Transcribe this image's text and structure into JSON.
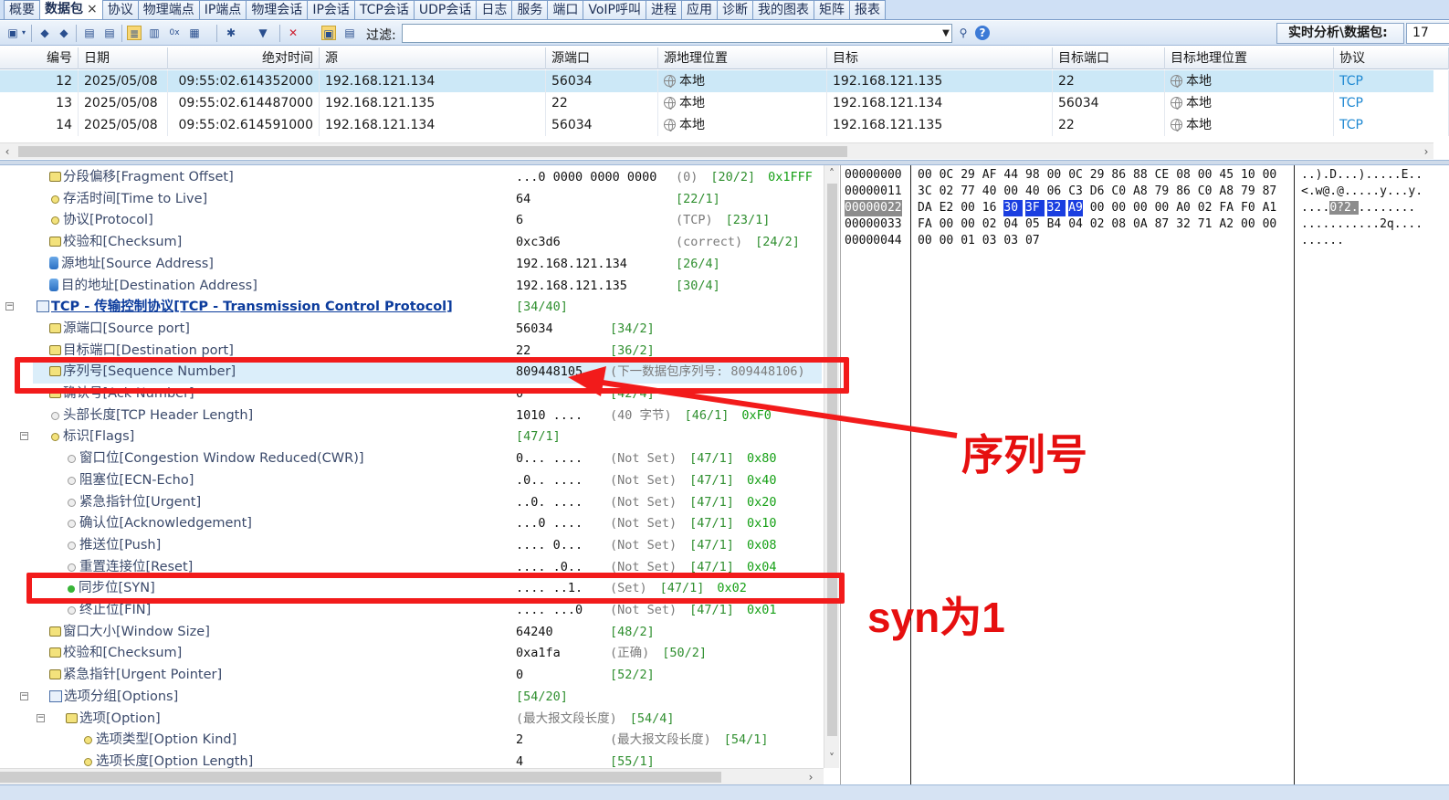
{
  "tabs": [
    {
      "label": "概要",
      "active": false
    },
    {
      "label": "数据包",
      "active": true,
      "close": "×"
    },
    {
      "label": "协议",
      "active": false
    },
    {
      "label": "物理端点",
      "active": false
    },
    {
      "label": "IP端点",
      "active": false
    },
    {
      "label": "物理会话",
      "active": false
    },
    {
      "label": "IP会话",
      "active": false
    },
    {
      "label": "TCP会话",
      "active": false
    },
    {
      "label": "UDP会话",
      "active": false
    },
    {
      "label": "日志",
      "active": false
    },
    {
      "label": "服务",
      "active": false
    },
    {
      "label": "端口",
      "active": false
    },
    {
      "label": "VoIP呼叫",
      "active": false
    },
    {
      "label": "进程",
      "active": false
    },
    {
      "label": "应用",
      "active": false
    },
    {
      "label": "诊断",
      "active": false
    },
    {
      "label": "我的图表",
      "active": false
    },
    {
      "label": "矩阵",
      "active": false
    },
    {
      "label": "报表",
      "active": false
    }
  ],
  "toolbar": {
    "filter_label": "过滤:",
    "filter_value": "",
    "realtime_label": "实时分析\\数据包:",
    "realtime_value": "17"
  },
  "packet_list": {
    "columns": [
      "编号",
      "日期",
      "绝对时间",
      "源",
      "源端口",
      "源地理位置",
      "目标",
      "目标端口",
      "目标地理位置",
      "协议"
    ],
    "rows": [
      {
        "no": "12",
        "date": "2025/05/08",
        "time": "09:55:02.614352000",
        "src": "192.168.121.134",
        "sport": "56034",
        "sgeo": "本地",
        "dst": "192.168.121.135",
        "dport": "22",
        "dgeo": "本地",
        "proto": "TCP",
        "selected": true
      },
      {
        "no": "13",
        "date": "2025/05/08",
        "time": "09:55:02.614487000",
        "src": "192.168.121.135",
        "sport": "22",
        "sgeo": "本地",
        "dst": "192.168.121.134",
        "dport": "56034",
        "dgeo": "本地",
        "proto": "TCP",
        "selected": false
      },
      {
        "no": "14",
        "date": "2025/05/08",
        "time": "09:55:02.614591000",
        "src": "192.168.121.134",
        "sport": "56034",
        "sgeo": "本地",
        "dst": "192.168.121.135",
        "dport": "22",
        "dgeo": "本地",
        "proto": "TCP",
        "selected": false
      }
    ]
  },
  "tree": [
    {
      "indent": 1,
      "icon": "field",
      "name": "分段偏移[Fragment Offset]",
      "value": "...0 0000 0000 0000",
      "desc": "(0)",
      "offset": "[20/2]",
      "hex": "0x1FFF"
    },
    {
      "indent": 1,
      "icon": "dot",
      "name": "存活时间[Time to Live]",
      "value": "64",
      "desc": "",
      "offset": "[22/1]",
      "hex": ""
    },
    {
      "indent": 1,
      "icon": "dot",
      "name": "协议[Protocol]",
      "value": "6",
      "desc": "(TCP)",
      "offset": "[23/1]",
      "hex": ""
    },
    {
      "indent": 1,
      "icon": "field",
      "name": "校验和[Checksum]",
      "value": "0xc3d6",
      "desc": "(correct)",
      "offset": "[24/2]",
      "hex": ""
    },
    {
      "indent": 1,
      "icon": "addr",
      "name": "源地址[Source Address]",
      "value": "192.168.121.134",
      "desc": "",
      "offset": "[26/4]",
      "hex": ""
    },
    {
      "indent": 1,
      "icon": "addr",
      "name": "目的地址[Destination Address]",
      "value": "192.168.121.135",
      "desc": "",
      "offset": "[30/4]",
      "hex": ""
    },
    {
      "indent": 0,
      "icon": "proto",
      "expander": "−",
      "name": "TCP - 传输控制协议[TCP - Transmission Control Protocol]",
      "value": "",
      "desc": "",
      "offset": "[34/40]",
      "hex": "",
      "title": true
    },
    {
      "indent": 1,
      "icon": "field",
      "name": "源端口[Source port]",
      "value": "56034",
      "desc": "",
      "offset": "[34/2]",
      "hex": ""
    },
    {
      "indent": 1,
      "icon": "field",
      "name": "目标端口[Destination port]",
      "value": "22",
      "desc": "",
      "offset": "[36/2]",
      "hex": ""
    },
    {
      "indent": 1,
      "icon": "field",
      "name": "序列号[Sequence Number]",
      "value": "809448105",
      "desc": "(下一数据包序列号: 809448106)",
      "offset": "",
      "hex": "",
      "highlight": true
    },
    {
      "indent": 1,
      "icon": "field",
      "name": "确认号[Ack Number]",
      "value": "0",
      "desc": "",
      "offset": "[42/4]",
      "hex": ""
    },
    {
      "indent": 1,
      "icon": "grey",
      "name": "头部长度[TCP Header Length]",
      "value": "1010 ....",
      "desc": "(40 字节)",
      "offset": "[46/1]",
      "hex": "0xF0"
    },
    {
      "indent": 1,
      "icon": "dot",
      "expander": "−",
      "name": "标识[Flags]",
      "value": "",
      "desc": "",
      "offset": "[47/1]",
      "hex": "",
      "valueAtCol": true
    },
    {
      "indent": 2,
      "icon": "grey",
      "name": "窗口位[Congestion Window Reduced(CWR)]",
      "value": "0... ....",
      "desc": "(Not Set)",
      "offset": "[47/1]",
      "hex": "0x80"
    },
    {
      "indent": 2,
      "icon": "grey",
      "name": "阻塞位[ECN-Echo]",
      "value": ".0.. ....",
      "desc": "(Not Set)",
      "offset": "[47/1]",
      "hex": "0x40"
    },
    {
      "indent": 2,
      "icon": "grey",
      "name": "紧急指针位[Urgent]",
      "value": "..0. ....",
      "desc": "(Not Set)",
      "offset": "[47/1]",
      "hex": "0x20"
    },
    {
      "indent": 2,
      "icon": "grey",
      "name": "确认位[Acknowledgement]",
      "value": "...0 ....",
      "desc": "(Not Set)",
      "offset": "[47/1]",
      "hex": "0x10"
    },
    {
      "indent": 2,
      "icon": "grey",
      "name": "推送位[Push]",
      "value": ".... 0...",
      "desc": "(Not Set)",
      "offset": "[47/1]",
      "hex": "0x08"
    },
    {
      "indent": 2,
      "icon": "grey",
      "name": "重置连接位[Reset]",
      "value": ".... .0..",
      "desc": "(Not Set)",
      "offset": "[47/1]",
      "hex": "0x04"
    },
    {
      "indent": 2,
      "icon": "green",
      "name": "同步位[SYN]",
      "value": ".... ..1.",
      "desc": "(Set)",
      "offset": "[47/1]",
      "hex": "0x02"
    },
    {
      "indent": 2,
      "icon": "grey",
      "name": "终止位[FIN]",
      "value": ".... ...0",
      "desc": "(Not Set)",
      "offset": "[47/1]",
      "hex": "0x01"
    },
    {
      "indent": 1,
      "icon": "field",
      "name": "窗口大小[Window Size]",
      "value": "64240",
      "desc": "",
      "offset": "[48/2]",
      "hex": ""
    },
    {
      "indent": 1,
      "icon": "field",
      "name": "校验和[Checksum]",
      "value": "0xa1fa",
      "desc": "(正确)",
      "offset": "[50/2]",
      "hex": ""
    },
    {
      "indent": 1,
      "icon": "field",
      "name": "紧急指针[Urgent Pointer]",
      "value": "0",
      "desc": "",
      "offset": "[52/2]",
      "hex": ""
    },
    {
      "indent": 1,
      "icon": "proto",
      "expander": "−",
      "name": "选项分组[Options]",
      "value": "",
      "desc": "",
      "offset": "[54/20]",
      "hex": "",
      "valueAtCol": true
    },
    {
      "indent": 2,
      "icon": "field",
      "expander": "−",
      "name": "选项[Option]",
      "value": "",
      "desc": "(最大报文段长度)",
      "offset": "[54/4]",
      "hex": "",
      "descAtCol": true
    },
    {
      "indent": 3,
      "icon": "dot",
      "name": "选项类型[Option Kind]",
      "value": "2",
      "desc": "(最大报文段长度)",
      "offset": "[54/1]",
      "hex": ""
    },
    {
      "indent": 3,
      "icon": "dot",
      "name": "选项长度[Option Length]",
      "value": "4",
      "desc": "",
      "offset": "[55/1]",
      "hex": ""
    }
  ],
  "hex": [
    {
      "addr": "00000000",
      "bytes": [
        "00",
        "0C",
        "29",
        "AF",
        "44",
        "98",
        "00",
        "0C",
        "29",
        "86",
        "88",
        "CE",
        "08",
        "00",
        "45",
        "10",
        "00"
      ],
      "ascii": "..).D...).....E.."
    },
    {
      "addr": "00000011",
      "bytes": [
        "3C",
        "02",
        "77",
        "40",
        "00",
        "40",
        "06",
        "C3",
        "D6",
        "C0",
        "A8",
        "79",
        "86",
        "C0",
        "A8",
        "79",
        "87"
      ],
      "ascii": "<.w@.@.....y...y."
    },
    {
      "addr": "00000022",
      "bytes": [
        "DA",
        "E2",
        "00",
        "16",
        "30",
        "3F",
        "32",
        "A9",
        "00",
        "00",
        "00",
        "00",
        "A0",
        "02",
        "FA",
        "F0",
        "A1"
      ],
      "ascii": "....0?2.........",
      "sel_start": 4,
      "sel_end": 7
    },
    {
      "addr": "00000033",
      "bytes": [
        "FA",
        "00",
        "00",
        "02",
        "04",
        "05",
        "B4",
        "04",
        "02",
        "08",
        "0A",
        "87",
        "32",
        "71",
        "A2",
        "00",
        "00"
      ],
      "ascii": "...........2q...."
    },
    {
      "addr": "00000044",
      "bytes": [
        "00",
        "00",
        "01",
        "03",
        "03",
        "07"
      ],
      "ascii": "......"
    }
  ],
  "annotations": {
    "seq_label": "序列号",
    "syn_label": "syn为1",
    "color": "#e60f0f"
  }
}
